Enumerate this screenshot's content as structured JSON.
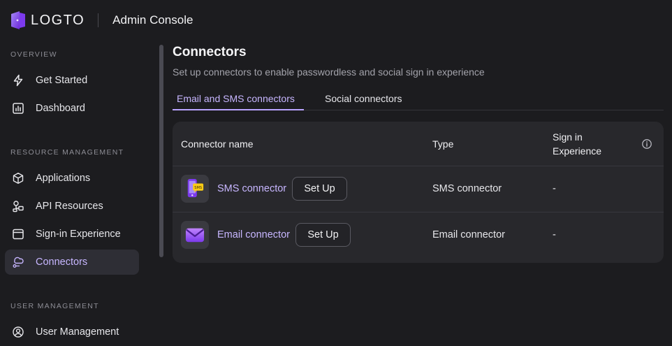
{
  "header": {
    "logo_text": "LOGTO",
    "console_title": "Admin Console"
  },
  "sidebar": {
    "sections": [
      {
        "title": "OVERVIEW",
        "items": [
          {
            "label": "Get Started",
            "icon": "lightning-icon"
          },
          {
            "label": "Dashboard",
            "icon": "chart-icon"
          }
        ]
      },
      {
        "title": "RESOURCE MANAGEMENT",
        "items": [
          {
            "label": "Applications",
            "icon": "cube-icon"
          },
          {
            "label": "API Resources",
            "icon": "resources-icon"
          },
          {
            "label": "Sign-in Experience",
            "icon": "window-icon"
          },
          {
            "label": "Connectors",
            "icon": "connector-icon",
            "active": true
          }
        ]
      },
      {
        "title": "USER MANAGEMENT",
        "items": [
          {
            "label": "User Management",
            "icon": "user-icon"
          }
        ]
      }
    ]
  },
  "main": {
    "title": "Connectors",
    "subtitle": "Set up connectors to enable passwordless and social sign in experience",
    "tabs": [
      {
        "label": "Email and SMS connectors",
        "active": true
      },
      {
        "label": "Social connectors",
        "active": false
      }
    ],
    "table": {
      "columns": [
        "Connector name",
        "Type",
        "Sign in",
        "Experience"
      ],
      "rows": [
        {
          "name": "SMS connector",
          "action": "Set Up",
          "type": "SMS connector",
          "sign_in": "-",
          "logo": "sms-logo-icon"
        },
        {
          "name": "Email connector",
          "action": "Set Up",
          "type": "Email connector",
          "sign_in": "-",
          "logo": "email-logo-icon"
        }
      ]
    }
  },
  "colors": {
    "background": "#1c1c1f",
    "accent": "#c7b6ff",
    "card": "#28282c",
    "active_nav": "#2e2e35"
  }
}
